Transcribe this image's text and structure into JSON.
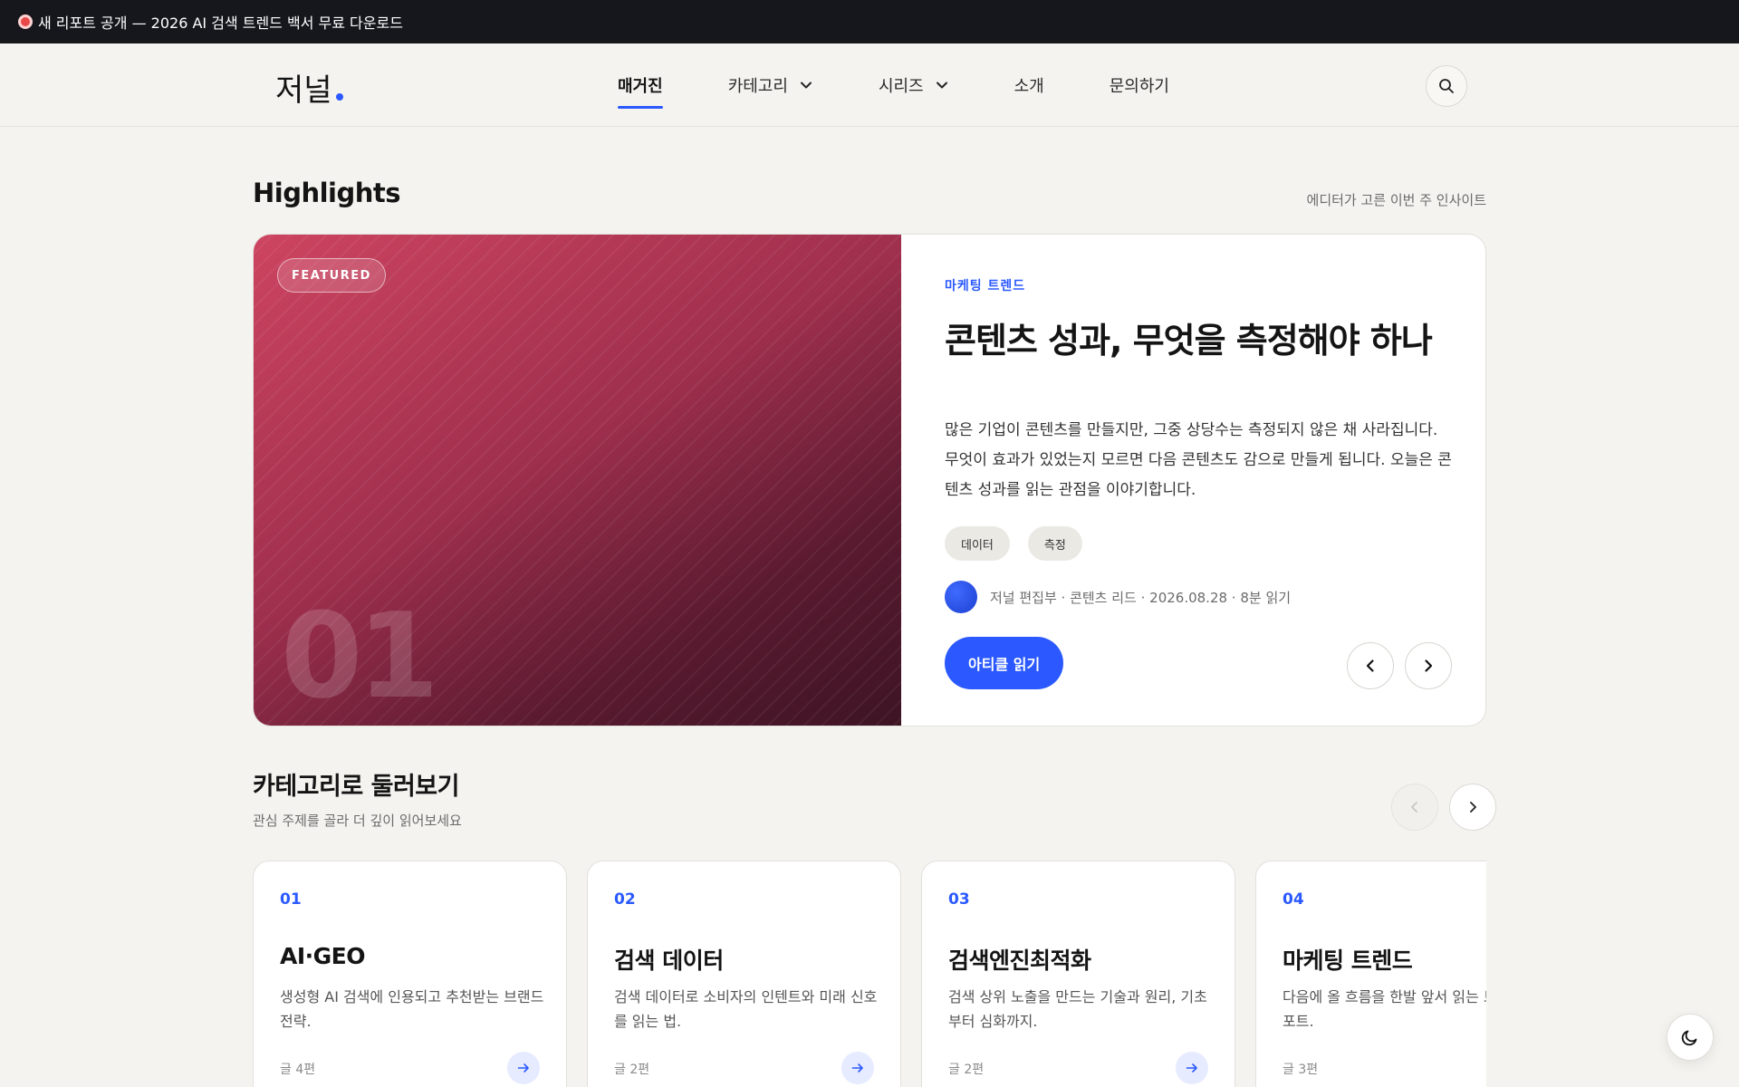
{
  "announcement": {
    "icon": "target-icon",
    "text": "새 리포트 공개 — 2026 AI 검색 트렌드 백서 무료 다운로드"
  },
  "header": {
    "logo": "저널",
    "nav": [
      {
        "label": "매거진",
        "active": true
      },
      {
        "label": "카테고리",
        "dropdown": true
      },
      {
        "label": "시리즈",
        "dropdown": true
      },
      {
        "label": "소개"
      },
      {
        "label": "문의하기"
      }
    ],
    "search_icon": "search-icon"
  },
  "highlights": {
    "title": "Highlights",
    "subtitle": "에디터가 고른 이번 주 인사이트",
    "featured": {
      "badge": "FEATURED",
      "number": "01",
      "category": "마케팅 트렌드",
      "title": "콘텐츠 성과, 무엇을 측정해야 하나",
      "description": "많은 기업이 콘텐츠를 만들지만, 그중 상당수는 측정되지 않은 채 사라집니다. 무엇이 효과가 있었는지 모르면 다음 콘텐츠도 감으로 만들게 됩니다. 오늘은 콘텐츠 성과를 읽는 관점을 이야기합니다.",
      "tags": [
        "데이터",
        "측정"
      ],
      "meta": "저널 편집부 · 콘텐츠 리드 · 2026.08.28 · 8분 읽기",
      "cta": "아티클 읽기",
      "image_colors": [
        "#cd4460",
        "#3d1424"
      ]
    }
  },
  "categories": {
    "title": "카테고리로 둘러보기",
    "subtitle": "관심 주제를 골라 더 깊이 읽어보세요",
    "items": [
      {
        "num": "01",
        "title": "AI·GEO",
        "desc": "생성형 AI 검색에 인용되고 추천받는 브랜드 전략.",
        "count": "글 4편"
      },
      {
        "num": "02",
        "title": "검색 데이터",
        "desc": "검색 데이터로 소비자의 인텐트와 미래 신호를 읽는 법.",
        "count": "글 2편"
      },
      {
        "num": "03",
        "title": "검색엔진최적화",
        "desc": "검색 상위 노출을 만드는 기술과 원리, 기초부터 심화까지.",
        "count": "글 2편"
      },
      {
        "num": "04",
        "title": "마케팅 트렌드",
        "desc": "다음에 올 흐름을 한발 앞서 읽는 트렌드 리포트.",
        "count": "글 3편"
      }
    ]
  },
  "theme_toggle_icon": "moon-icon",
  "colors": {
    "accent": "#2b59ff",
    "topbar": "#16171d",
    "background": "#f4f3ef"
  }
}
